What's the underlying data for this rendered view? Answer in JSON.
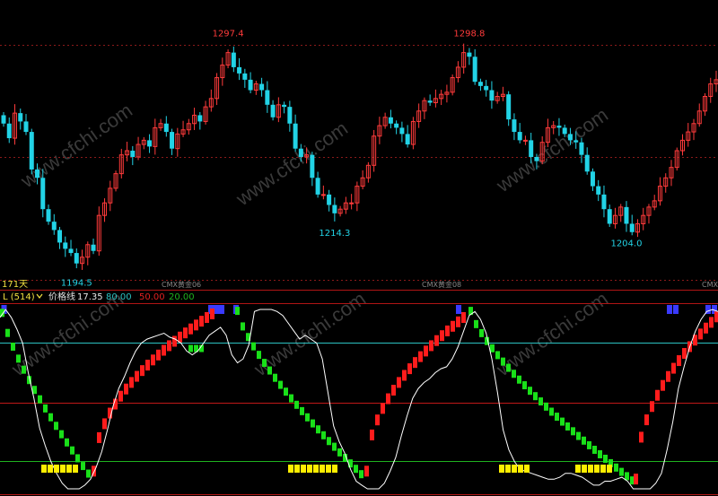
{
  "colors": {
    "background": "#000000",
    "up": "#ff3b3b",
    "down": "#22d3e6",
    "panel_border": "#b01515",
    "dotted": "#8b1a1a",
    "text_white": "#e6e6e6",
    "text_yellow": "#f0e040",
    "price_line": "#ffffff",
    "level_high": "#2bc2c2",
    "level_mid": "#c01818",
    "level_low": "#1fb21f",
    "rising_block": "#ff1c1c",
    "falling_block": "#19e019",
    "signal_top": "#3a3aff",
    "signal_bottom": "#ffee00"
  },
  "top_panel": {
    "period_label": "171天",
    "contract_labels": [
      "CMX黄金06",
      "CMX黄金08",
      "CMX"
    ],
    "watermark": "www.cfchi.com"
  },
  "indicator_header": {
    "name": "L (514)",
    "line_name": "价格线",
    "line_value": "17.35",
    "level_high": "80.00",
    "level_mid": "50.00",
    "level_low": "20.00"
  },
  "chart_data": [
    {
      "type": "candlestick",
      "title": "",
      "xlabel": "",
      "ylabel": "",
      "ylim": [
        1188,
        1304
      ],
      "grid": "dotted horizontal",
      "annotations": [
        {
          "label": "1297.4",
          "type": "high",
          "index": 40
        },
        {
          "label": "1214.3",
          "type": "low",
          "index": 59
        },
        {
          "label": "1298.8",
          "type": "high",
          "index": 83
        },
        {
          "label": "1194.5",
          "type": "low",
          "index": 13
        },
        {
          "label": "1204.0",
          "type": "low",
          "index": 111
        }
      ],
      "close": [
        1262,
        1255,
        1267,
        1263,
        1258,
        1240,
        1236,
        1221,
        1215,
        1211,
        1205,
        1202,
        1200,
        1195,
        1198,
        1204,
        1201,
        1218,
        1224,
        1231,
        1238,
        1247,
        1249,
        1246,
        1252,
        1254,
        1251,
        1260,
        1262,
        1258,
        1250,
        1257,
        1259,
        1262,
        1266,
        1263,
        1270,
        1274,
        1284,
        1290,
        1296,
        1289,
        1286,
        1283,
        1278,
        1281,
        1278,
        1271,
        1265,
        1271,
        1270,
        1262,
        1250,
        1246,
        1247,
        1236,
        1228,
        1228,
        1223,
        1219,
        1221,
        1224,
        1224,
        1232,
        1236,
        1242,
        1256,
        1261,
        1265,
        1262,
        1260,
        1257,
        1252,
        1263,
        1268,
        1273,
        1272,
        1274,
        1276,
        1277,
        1284,
        1289,
        1296,
        1294,
        1282,
        1280,
        1278,
        1273,
        1275,
        1276,
        1264,
        1258,
        1254,
        1254,
        1246,
        1244,
        1253,
        1260,
        1261,
        1260,
        1257,
        1254,
        1253,
        1247,
        1239,
        1232,
        1228,
        1221,
        1214,
        1218,
        1222,
        1214,
        1210,
        1214,
        1218,
        1222,
        1225,
        1232,
        1236,
        1241,
        1249,
        1254,
        1258,
        1262,
        1268,
        1275,
        1281,
        1283
      ]
    },
    {
      "type": "line",
      "title": "",
      "series_name": "价格线",
      "ylim": [
        0,
        110
      ],
      "levels": [
        80,
        50,
        20
      ],
      "price_line": [
        93,
        97,
        93,
        87,
        80,
        65,
        52,
        37,
        28,
        20,
        14,
        9,
        5,
        4,
        5,
        8,
        11,
        17,
        25,
        36,
        48,
        57,
        63,
        70,
        76,
        80,
        82,
        83,
        84,
        85,
        83,
        82,
        80,
        76,
        74,
        76,
        80,
        84,
        86,
        88,
        84,
        74,
        70,
        72,
        79,
        96,
        102,
        101,
        98,
        96,
        94,
        90,
        86,
        82,
        84,
        82,
        80,
        72,
        55,
        38,
        30,
        24,
        16,
        10,
        8,
        6,
        5,
        6,
        9,
        15,
        22,
        33,
        43,
        52,
        57,
        60,
        62,
        65,
        67,
        68,
        72,
        78,
        86,
        94,
        96,
        92,
        85,
        72,
        55,
        36,
        26,
        20,
        16,
        15,
        14,
        13,
        12,
        11,
        11,
        12,
        14,
        14,
        13,
        12,
        10,
        8,
        8,
        10,
        10,
        11,
        12,
        10,
        6,
        5,
        4,
        6,
        9,
        14,
        26,
        40,
        57,
        68,
        78,
        86,
        92,
        96,
        97,
        96
      ],
      "red_rising_blocks": [
        [
          18,
          30
        ],
        [
          24,
          35
        ],
        [
          30,
          40
        ],
        [
          36,
          45
        ],
        [
          42,
          50
        ],
        [
          48,
          54
        ],
        [
          54,
          58
        ],
        [
          60,
          62
        ],
        [
          66,
          66
        ],
        [
          70,
          69
        ],
        [
          74,
          71
        ],
        [
          78,
          73
        ],
        [
          82,
          74
        ],
        [
          86,
          76
        ],
        [
          90,
          78
        ],
        [
          94,
          79
        ],
        [
          98,
          80
        ],
        [
          103,
          82
        ],
        [
          108,
          83
        ],
        [
          113,
          83
        ],
        [
          118,
          84
        ],
        [
          123,
          84
        ],
        [
          127,
          85
        ],
        [
          131,
          86
        ],
        [
          135,
          87
        ],
        [
          139,
          87
        ],
        [
          143,
          88
        ],
        [
          147,
          89
        ],
        [
          151,
          89
        ],
        [
          155,
          90
        ],
        [
          159,
          90
        ],
        [
          163,
          91
        ],
        [
          167,
          92
        ],
        [
          171,
          93
        ],
        [
          175,
          94
        ],
        [
          179,
          94
        ],
        [
          183,
          95
        ],
        [
          189,
          96
        ],
        [
          193,
          96
        ],
        [
          197,
          97
        ]
      ],
      "green_falling_blocks": [
        [
          0,
          97
        ],
        [
          4,
          94
        ],
        [
          8,
          90
        ],
        [
          12,
          86
        ],
        [
          16,
          82
        ],
        [
          20,
          78
        ],
        [
          24,
          73
        ],
        [
          28,
          67
        ],
        [
          32,
          61
        ],
        [
          36,
          56
        ],
        [
          40,
          50
        ],
        [
          44,
          45
        ],
        [
          48,
          40
        ],
        [
          52,
          35
        ],
        [
          56,
          30
        ],
        [
          60,
          26
        ],
        [
          64,
          23
        ],
        [
          68,
          21
        ],
        [
          72,
          19
        ],
        [
          76,
          18
        ],
        [
          80,
          17
        ],
        [
          84,
          16
        ],
        [
          88,
          15
        ],
        [
          92,
          14
        ],
        [
          96,
          14
        ],
        [
          100,
          13
        ],
        [
          104,
          13
        ],
        [
          108,
          12
        ],
        [
          112,
          12
        ],
        [
          116,
          11
        ],
        [
          120,
          11
        ],
        [
          124,
          11
        ],
        [
          128,
          11
        ],
        [
          132,
          12
        ],
        [
          136,
          12
        ],
        [
          140,
          12
        ],
        [
          144,
          13
        ],
        [
          148,
          13
        ],
        [
          152,
          13
        ],
        [
          156,
          14
        ]
      ],
      "signal_top_positions": [
        1.5,
        232,
        238,
        244,
        260,
        508,
        743,
        750,
        786,
        793
      ],
      "signal_bottom_ranges": [
        [
          46,
          86
        ],
        [
          321,
          378
        ],
        [
          556,
          590
        ],
        [
          641,
          683
        ]
      ]
    }
  ]
}
